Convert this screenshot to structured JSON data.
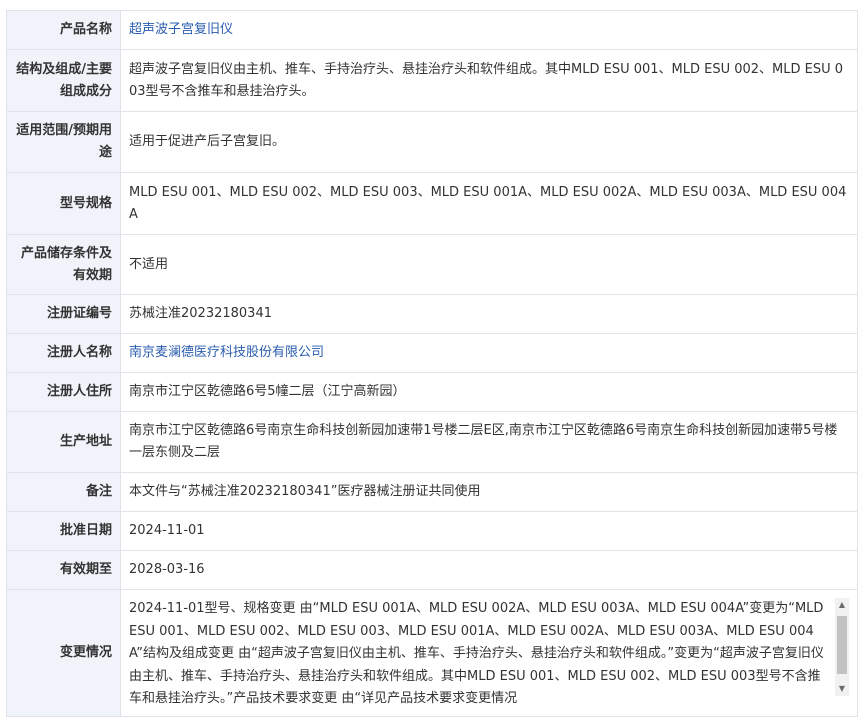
{
  "rows": [
    {
      "label": "产品名称",
      "value": "超声波子宫复旧仪"
    },
    {
      "label": "结构及组成/主要组成成分",
      "value": "超声波子宫复旧仪由主机、推车、手持治疗头、悬挂治疗头和软件组成。其中MLD ESU 001、MLD ESU 002、MLD ESU 003型号不含推车和悬挂治疗头。"
    },
    {
      "label": "适用范围/预期用途",
      "value": "适用于促进产后子宫复旧。"
    },
    {
      "label": "型号规格",
      "value": "MLD ESU 001、MLD ESU 002、MLD ESU 003、MLD ESU 001A、MLD ESU 002A、MLD ESU 003A、MLD ESU 004A"
    },
    {
      "label": "产品储存条件及有效期",
      "value": "不适用"
    },
    {
      "label": "注册证编号",
      "value": "苏械注准20232180341"
    },
    {
      "label": "注册人名称",
      "value": "南京麦澜德医疗科技股份有限公司"
    },
    {
      "label": "注册人住所",
      "value": "南京市江宁区乾德路6号5幢二层（江宁高新园）"
    },
    {
      "label": "生产地址",
      "value": "南京市江宁区乾德路6号南京生命科技创新园加速带1号楼二层E区,南京市江宁区乾德路6号南京生命科技创新园加速带5号楼一层东侧及二层"
    },
    {
      "label": "备注",
      "value": "本文件与“苏械注准20232180341”医疗器械注册证共同使用"
    },
    {
      "label": "批准日期",
      "value": "2024-11-01"
    },
    {
      "label": "有效期至",
      "value": "2028-03-16"
    },
    {
      "label": "变更情况",
      "value": "2024-11-01型号、规格变更 由“MLD ESU 001A、MLD ESU 002A、MLD ESU 003A、MLD ESU 004A”变更为“MLD ESU 001、MLD ESU 002、MLD ESU 003、MLD ESU 001A、MLD ESU 002A、MLD ESU 003A、MLD ESU 004A”结构及组成变更 由“超声波子宫复旧仪由主机、推车、手持治疗头、悬挂治疗头和软件组成。”变更为“超声波子宫复旧仪由主机、推车、手持治疗头、悬挂治疗头和软件组成。其中MLD ESU 001、MLD ESU 002、MLD ESU 003型号不含推车和悬挂治疗头。”产品技术要求变更 由“详见产品技术要求变更情况"
    }
  ],
  "colors": {
    "label_bg": "#f0f3fa",
    "border": "#dfe3ea",
    "link": "#2a5db0"
  },
  "icons": {
    "scroll_up": "triangle-up-icon",
    "scroll_down": "triangle-down-icon"
  }
}
